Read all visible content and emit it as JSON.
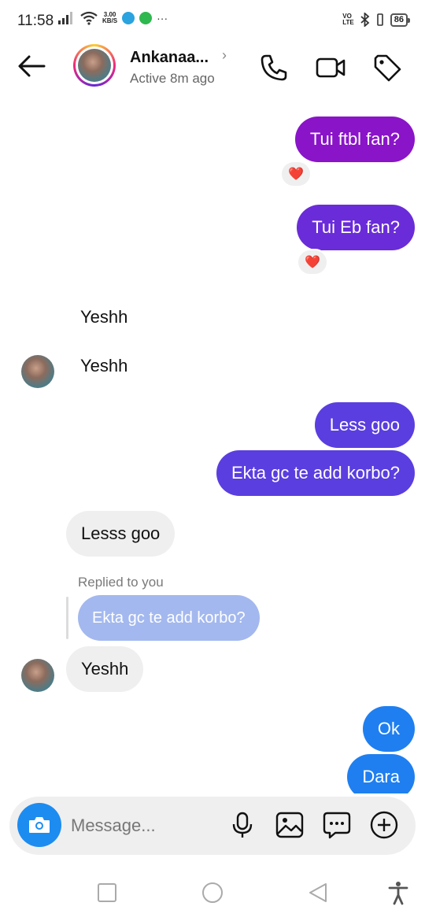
{
  "status_bar": {
    "time": "11:58",
    "net_speed_value": "3.00",
    "net_speed_unit": "KB/S",
    "volte_top": "VO",
    "volte_bottom": "LTE",
    "battery": "86"
  },
  "header": {
    "name": "Ankanaa...",
    "status": "Active 8m ago",
    "icons": [
      "back-arrow-icon",
      "phone-icon",
      "video-camera-icon",
      "tag-icon"
    ]
  },
  "messages": {
    "m1": "Tui ftbl fan?",
    "m1_reaction": "❤️",
    "m2": "Tui Eb fan?",
    "m2_reaction": "❤️",
    "m3": "Yeshh",
    "m4": "Yeshh",
    "m5": "Less goo",
    "m6": "Ekta gc te add korbo?",
    "m7": "Lesss goo",
    "reply_label": "Replied to you",
    "reply_quote": "Ekta gc te add korbo?",
    "m8": "Yeshh",
    "m9": "Ok",
    "m10": "Dara"
  },
  "composer": {
    "placeholder": "Message...",
    "icons": [
      "camera-icon",
      "microphone-icon",
      "gallery-icon",
      "sticker-icon",
      "plus-icon"
    ]
  },
  "colors": {
    "purple": "#8a14c8",
    "violet": "#6a2cd8",
    "indigo": "#5b3ee0",
    "blue": "#1f7ff0",
    "incoming": "#efefef",
    "reply_quote": "#a3b8ee"
  }
}
